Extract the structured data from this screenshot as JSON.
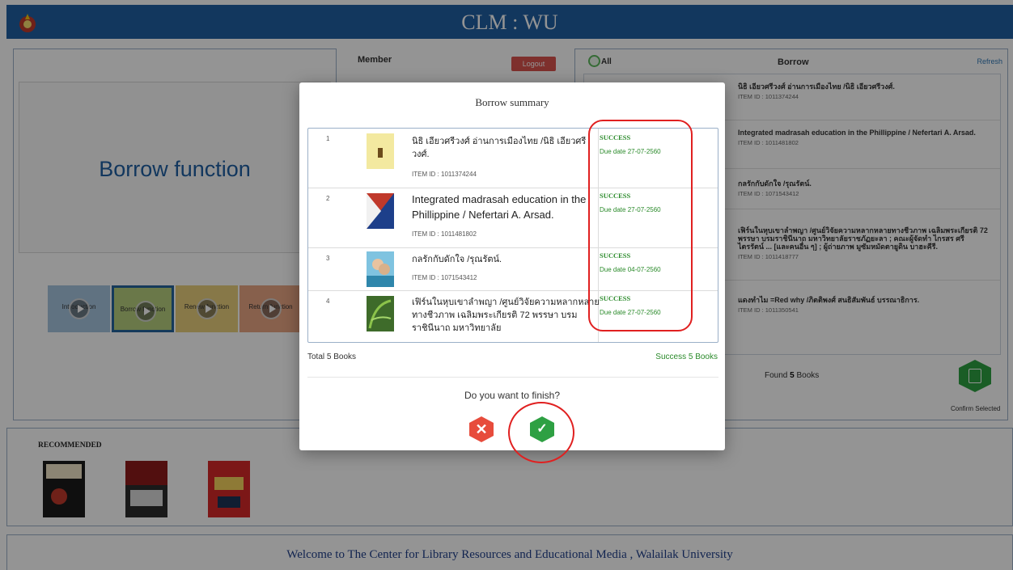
{
  "header": {
    "title": "CLM : WU",
    "logo_icon": "university-seal-icon"
  },
  "left_panel": {
    "video_title": "Borrow function",
    "thumbnails": [
      {
        "label": "Introduction"
      },
      {
        "label": "Borrow function"
      },
      {
        "label": "Renew function"
      },
      {
        "label": "Return function"
      }
    ]
  },
  "member_panel": {
    "title": "Member",
    "logout_label": "Logout"
  },
  "borrow_panel": {
    "all_label": "All",
    "title": "Borrow",
    "refresh_label": "Refresh",
    "items": [
      {
        "title": "นิธิ เอียวศรีวงศ์ อ่านการเมืองไทย /นิธิ เอียวศรีวงศ์.",
        "item_id": "ITEM ID : 1011374244"
      },
      {
        "title": "Integrated madrasah education in the Phillippine / Nefertari A. Arsad.",
        "item_id": "ITEM ID : 1011481802"
      },
      {
        "title": "กลรักกับดักใจ /รุณรัตน์.",
        "item_id": "ITEM ID : 1071543412"
      },
      {
        "title": "เฟิร์นในหุบเขาลำพญา /ศูนย์วิจัยความหลากหลายทางชีวภาพ เฉลิมพระเกียรติ 72 พรรษา บรมราชินีนาถ มหาวิทยาลัยราชภัฏยะลา ; คณะผู้จัดทำ ไกรสร ศรีไตรรัตน์ ... [และคนอื่น ๆ] ; ผู้ถ่ายภาพ มูซัมหมัดตายูดิน บาฮะคีรี.",
        "item_id": "ITEM ID : 1011418777"
      },
      {
        "title": "แดงทำไม =Red why /ภิตติพงศ์ สนธิสัมพันธ์ บรรณาธิการ.",
        "item_id": "ITEM ID : 1011350541"
      }
    ],
    "found_prefix": "Found",
    "found_count": "5",
    "found_suffix": "Books",
    "confirm_label": "Confirm Selected"
  },
  "recommended": {
    "title": "RECOMMENDED"
  },
  "footer": {
    "text": "Welcome to The Center for Library Resources and Educational Media , Walailak University"
  },
  "modal": {
    "title": "Borrow summary",
    "rows": [
      {
        "num": "1",
        "title": "นิธิ เอียวศรีวงศ์ อ่านการเมืองไทย /นิธิ เอียวศรีวงศ์.",
        "item_id": "ITEM ID : 1011374244",
        "status": "SUCCESS",
        "due": "Due date 27-07-2560"
      },
      {
        "num": "2",
        "title": "Integrated madrasah education in the Phillippine / Nefertari A. Arsad.",
        "item_id": "ITEM ID : 1011481802",
        "status": "SUCCESS",
        "due": "Due date 27-07-2560"
      },
      {
        "num": "3",
        "title": "กลรักกับดักใจ /รุณรัตน์.",
        "item_id": "ITEM ID : 1071543412",
        "status": "SUCCESS",
        "due": "Due date 04-07-2560"
      },
      {
        "num": "4",
        "title": "เฟิร์นในหุบเขาลำพญา /ศูนย์วิจัยความหลากหลายทางชีวภาพ เฉลิมพระเกียรติ 72 พรรษา บรมราชินีนาถ มหาวิทยาลัย",
        "item_id": "",
        "status": "SUCCESS",
        "due": "Due date 27-07-2560"
      }
    ],
    "total_label": "Total 5 Books",
    "success_label": "Success 5 Books",
    "question": "Do you want to finish?",
    "cancel_icon": "close-icon",
    "confirm_icon": "check-icon"
  },
  "colors": {
    "header": "#1f5fa3",
    "success": "#2a8a2a",
    "cancel": "#e74c3c",
    "confirm": "#2ea043",
    "annotation": "#e02020"
  }
}
